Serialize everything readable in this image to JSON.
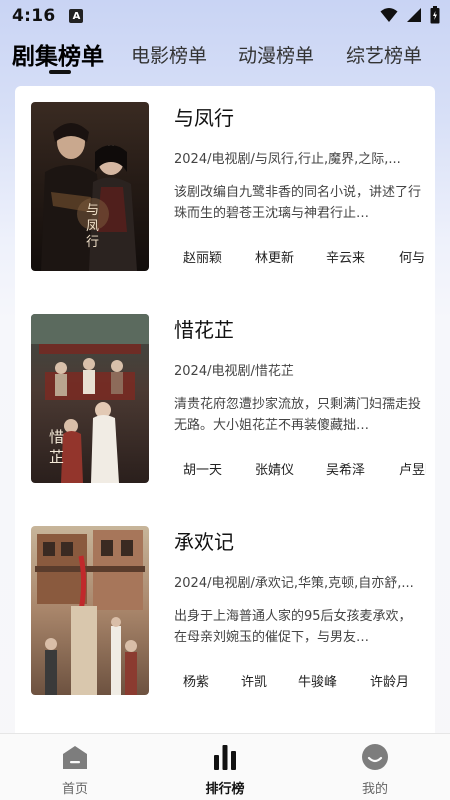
{
  "status_bar": {
    "time": "4:16",
    "app_icon_letter": "A"
  },
  "tabs": [
    {
      "label": "剧集榜单",
      "active": true
    },
    {
      "label": "电影榜单",
      "active": false
    },
    {
      "label": "动漫榜单",
      "active": false
    },
    {
      "label": "综艺榜单",
      "active": false
    }
  ],
  "dramas": [
    {
      "title": "与凤行",
      "meta": "2024/电视剧/与凤行,行止,魔界,之际,...",
      "description": "该剧改编自九鹭非香的同名小说，讲述了行珠而生的碧苍王沈璃与神君行止…",
      "cast": [
        "赵丽颖",
        "林更新",
        "辛云来",
        "何与"
      ]
    },
    {
      "title": "惜花芷",
      "meta": "2024/电视剧/惜花芷",
      "description": "清贵花府忽遭抄家流放，只剩满门妇孺走投无路。大小姐花芷不再装傻藏拙…",
      "cast": [
        "胡一天",
        "张婧仪",
        "吴希泽",
        "卢昱晓"
      ]
    },
    {
      "title": "承欢记",
      "meta": "2024/电视剧/承欢记,华策,克顿,自亦舒,...",
      "description": "出身于上海普通人家的95后女孩麦承欢，在母亲刘婉玉的催促下，与男友…",
      "cast": [
        "杨紫",
        "许凯",
        "牛骏峰",
        "许龄月"
      ]
    }
  ],
  "bottom_nav": [
    {
      "label": "首页",
      "icon": "home-icon",
      "active": false
    },
    {
      "label": "排行榜",
      "icon": "ranking-bars-icon",
      "active": true
    },
    {
      "label": "我的",
      "icon": "profile-smile-icon",
      "active": false
    }
  ],
  "colors": {
    "header_gradient_top": "#c9d4f4",
    "card_background": "#ffffff",
    "text_primary": "#111111",
    "text_secondary": "#444444"
  }
}
